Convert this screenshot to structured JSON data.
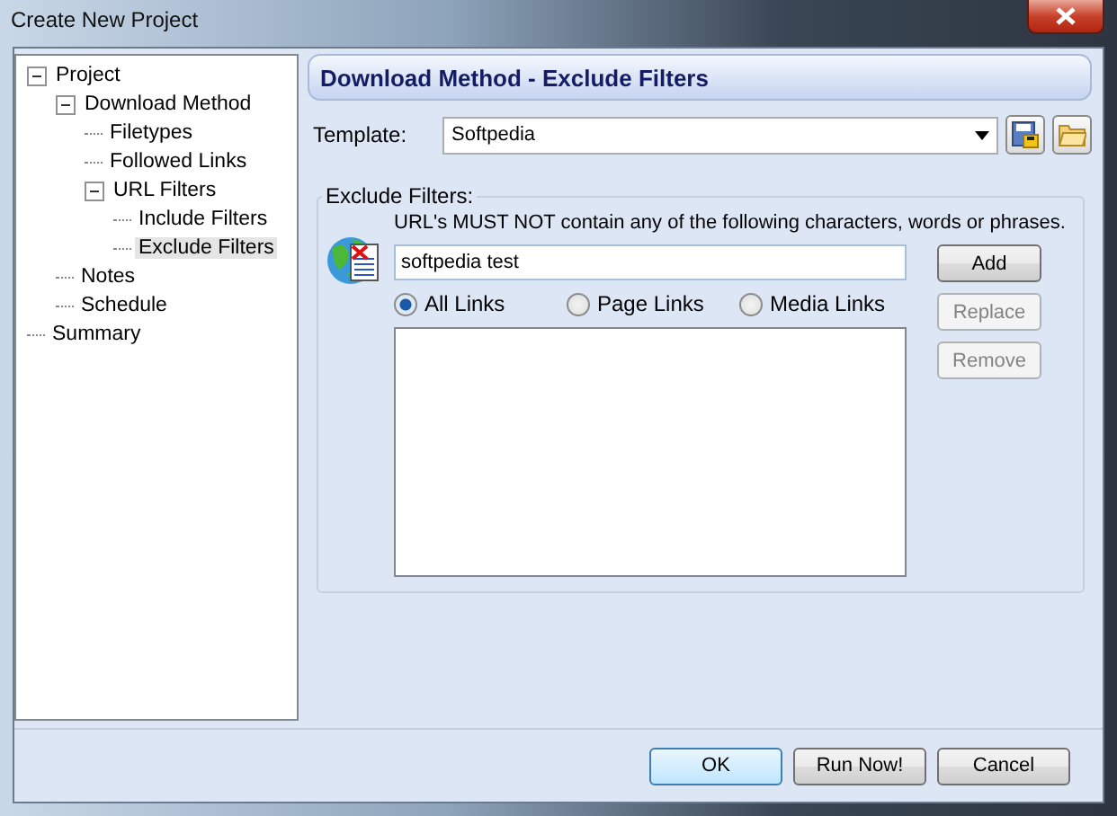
{
  "window": {
    "title": "Create New Project"
  },
  "tree": [
    {
      "label": "Project",
      "expanded": true,
      "selected": false,
      "children": [
        {
          "label": "Download Method",
          "expanded": true,
          "selected": false,
          "children": [
            {
              "label": "Filetypes",
              "selected": false
            },
            {
              "label": "Followed Links",
              "selected": false
            },
            {
              "label": "URL Filters",
              "expanded": true,
              "selected": false,
              "children": [
                {
                  "label": "Include Filters",
                  "selected": false
                },
                {
                  "label": "Exclude Filters",
                  "selected": true
                }
              ]
            }
          ]
        },
        {
          "label": "Notes",
          "selected": false
        },
        {
          "label": "Schedule",
          "selected": false
        }
      ]
    },
    {
      "label": "Summary",
      "selected": false
    }
  ],
  "header": "Download Method - Exclude Filters",
  "template": {
    "label": "Template:",
    "value": "Softpedia"
  },
  "group": {
    "title": "Exclude Filters:",
    "description": "URL's MUST NOT contain any of the following characters, words or phrases.",
    "input": "softpedia test",
    "radios": [
      {
        "label": "All Links",
        "selected": true
      },
      {
        "label": "Page Links",
        "selected": false
      },
      {
        "label": "Media Links",
        "selected": false
      }
    ],
    "buttons": [
      {
        "label": "Add",
        "disabled": false
      },
      {
        "label": "Replace",
        "disabled": true
      },
      {
        "label": "Remove",
        "disabled": true
      }
    ]
  },
  "footer_buttons": [
    {
      "label": "OK",
      "default": true
    },
    {
      "label": "Run Now!",
      "default": false
    },
    {
      "label": "Cancel",
      "default": false
    }
  ]
}
